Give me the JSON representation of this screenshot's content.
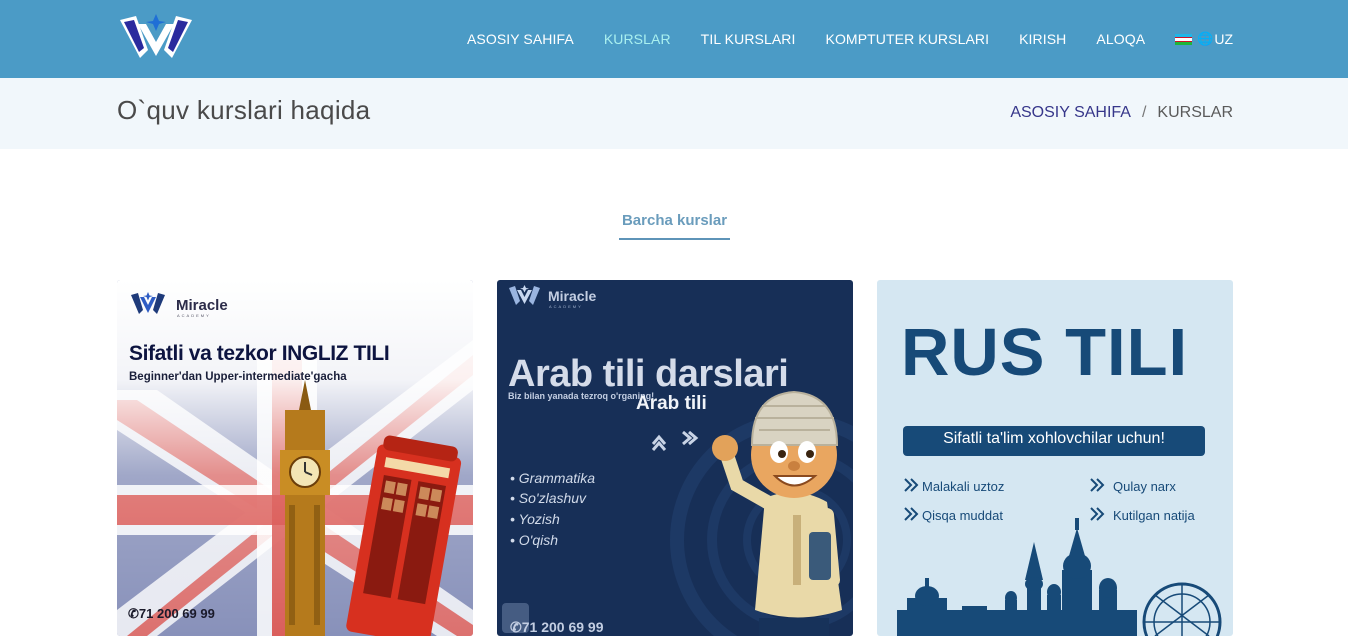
{
  "navbar": {
    "items": [
      {
        "label": "ASOSIY SAHIFA"
      },
      {
        "label": "KURSLAR"
      },
      {
        "label": "TIL KURSLARI"
      },
      {
        "label": "KOMPTUTER KURSLARI"
      },
      {
        "label": "KIRISH"
      },
      {
        "label": "ALOQA"
      }
    ],
    "lang": "UZ",
    "active_color": "#a9f0ef",
    "bg_color": "#4b9bc6"
  },
  "page_header": {
    "title": "O`quv kurslari haqida",
    "breadcrumb_home": "ASOSIY SAHIFA",
    "breadcrumb_sep": "/",
    "breadcrumb_current": "KURSLAR"
  },
  "filter": {
    "label": "Barcha kurslar"
  },
  "courses": [
    {
      "brand": "Miracle",
      "brand_sub": "ACADEMY",
      "headline": "Sifatli va tezkor INGLIZ TILI",
      "subline": "Beginner'dan Upper-intermediate'gacha",
      "phone": "71 200 69 99"
    },
    {
      "brand": "Miracle",
      "brand_sub": "ACADEMY",
      "headline": "Arab tili darslari",
      "tagline": "Biz bilan yanada tezroq o'rganing!",
      "overlay_title": "Arab tili",
      "bullets": [
        "• Grammatika",
        "• So'zlashuv",
        "• Yozish",
        "• O'qish"
      ],
      "phone": "71 200 69 99"
    },
    {
      "headline": "RUS TILI",
      "banner": "Sifatli ta'lim xohlovchilar uchun!",
      "features": [
        "Malakali uztoz",
        "Qulay narx",
        "Qisqa muddat",
        "Kutilgan natija"
      ]
    }
  ]
}
